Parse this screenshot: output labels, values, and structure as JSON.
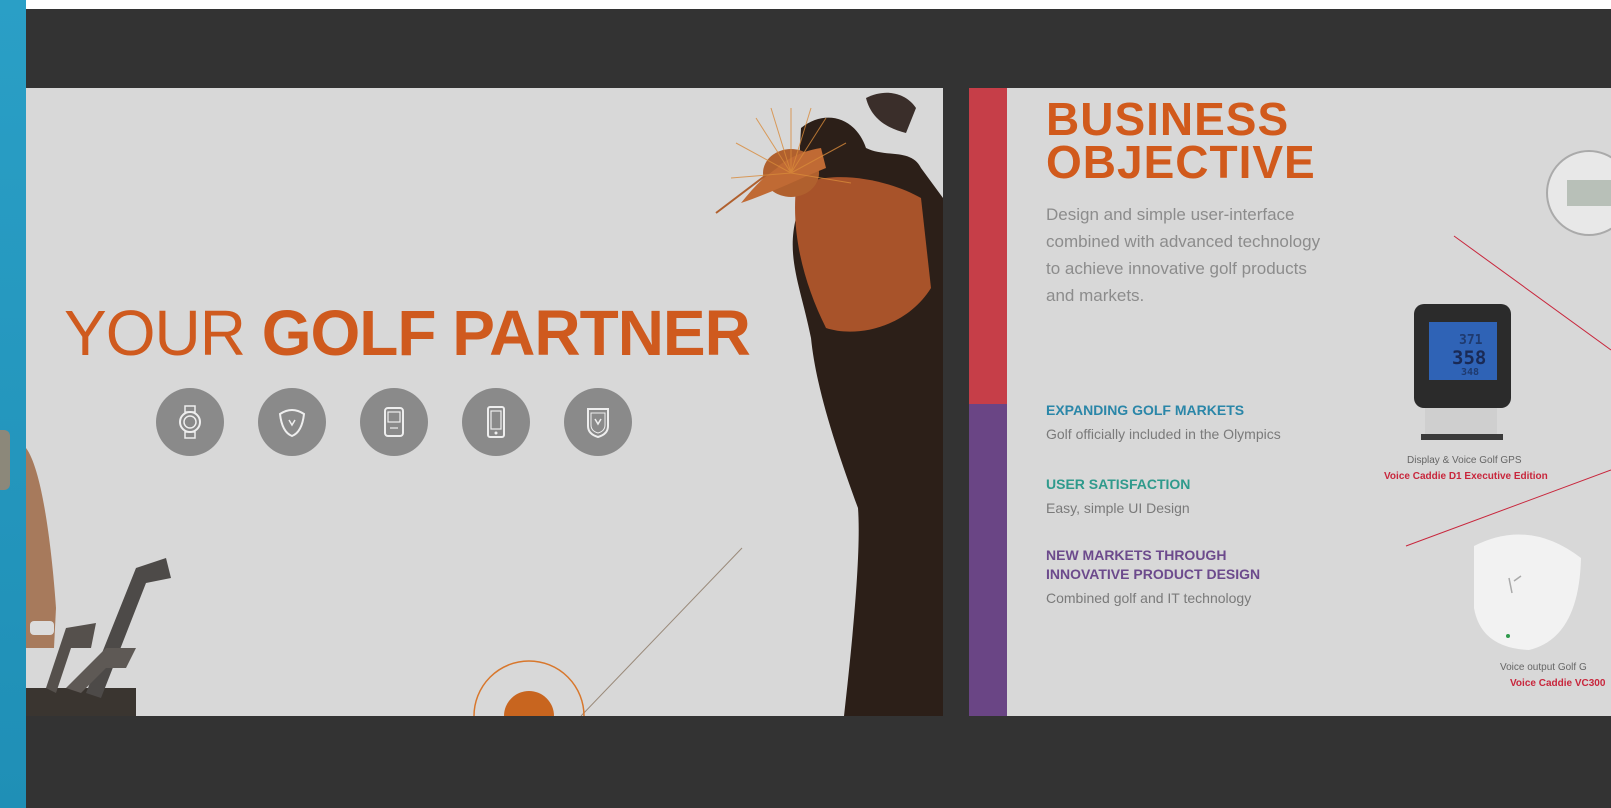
{
  "slide1": {
    "title_light": "YOUR",
    "title_bold": "GOLF PARTNER",
    "icons": [
      "golf-watch-icon",
      "voice-caddie-icon",
      "gps-device-icon",
      "rangefinder-icon",
      "shield-badge-icon"
    ]
  },
  "slide2": {
    "heading_line1": "BUSINESS",
    "heading_line2": "OBJECTIVE",
    "intro": "Design and simple user-interface combined with advanced technology to achieve innovative golf products and markets.",
    "objectives": [
      {
        "title": "EXPANDING GOLF MARKETS",
        "desc": "Golf officially included in the Olympics"
      },
      {
        "title": "USER SATISFACTION",
        "desc": "Easy, simple UI Design"
      },
      {
        "title": "NEW MARKETS THROUGH\nINNOVATIVE PRODUCT DESIGN",
        "desc": "Combined golf and IT technology"
      }
    ],
    "device1": {
      "caption": "Display & Voice Golf GPS",
      "product": "Voice Caddie D1 Executive Edition",
      "screen_values": [
        "371",
        "358",
        "348"
      ]
    },
    "device2": {
      "caption": "Voice output Golf G",
      "product": "Voice Caddie VC300"
    }
  },
  "colors": {
    "orange": "#cf5a1e",
    "red_bar": "#c63e48",
    "purple_bar": "#6a4585",
    "blue": "#2a86a8",
    "teal": "#2f9a8c",
    "purple": "#6c4a8c",
    "viewer_bg": "#333333",
    "left_strip": "#2a9fc6"
  }
}
